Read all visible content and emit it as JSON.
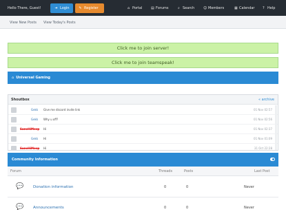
{
  "header": {
    "greeting": "Hello There, Guest!",
    "login": {
      "label": "Login",
      "icon": "login-icon"
    },
    "register": {
      "label": "Register",
      "icon": "register-icon"
    },
    "nav": [
      {
        "label": "Portal",
        "icon": "home-icon"
      },
      {
        "label": "Forums",
        "icon": "forums-icon"
      },
      {
        "label": "Search",
        "icon": "search-icon"
      },
      {
        "label": "Members",
        "icon": "members-icon"
      },
      {
        "label": "Calendar",
        "icon": "calendar-icon"
      },
      {
        "label": "Help",
        "icon": "help-icon"
      }
    ]
  },
  "subnav": {
    "new_posts": "View New Posts",
    "todays_posts": "View Today's Posts"
  },
  "banners": {
    "server": "Click me to join server!",
    "teamspeak": "Click me to join teamspeak!"
  },
  "community_bar": {
    "title": "Universal Gaming"
  },
  "shoutbox": {
    "title": "Shoutbox",
    "archive": "« archive",
    "rows": [
      {
        "user": "Gekk",
        "message": "Give me discord invite link",
        "time": "01 Nov 02:57"
      },
      {
        "user": "Gekk",
        "message": "Why u off?",
        "time": "01 Nov 02:56"
      },
      {
        "user": "SuneHiMeep",
        "message": "Hi",
        "time": "01 Nov 02:37"
      },
      {
        "user": "Gekk",
        "message": "Hi",
        "time": "01 Nov 01:09"
      },
      {
        "user": "SuneHiMeep",
        "message": "Hi",
        "time": "31 Oct 22:28"
      }
    ]
  },
  "community_info": {
    "title": "Community Information",
    "columns": {
      "forum": "Forum",
      "threads": "Threads",
      "posts": "Posts",
      "last_post": "Last Post"
    },
    "forums": [
      {
        "name": "Donation information",
        "threads": "0",
        "posts": "0",
        "last_post": "Never"
      },
      {
        "name": "Announcements",
        "threads": "0",
        "posts": "0",
        "last_post": "Never"
      }
    ]
  },
  "colors": {
    "topbar": "#262c33",
    "accent_blue": "#2a8ad4",
    "login": "#2f8dd4",
    "register": "#e68a2e",
    "banner_green": "#cbf2a6"
  }
}
